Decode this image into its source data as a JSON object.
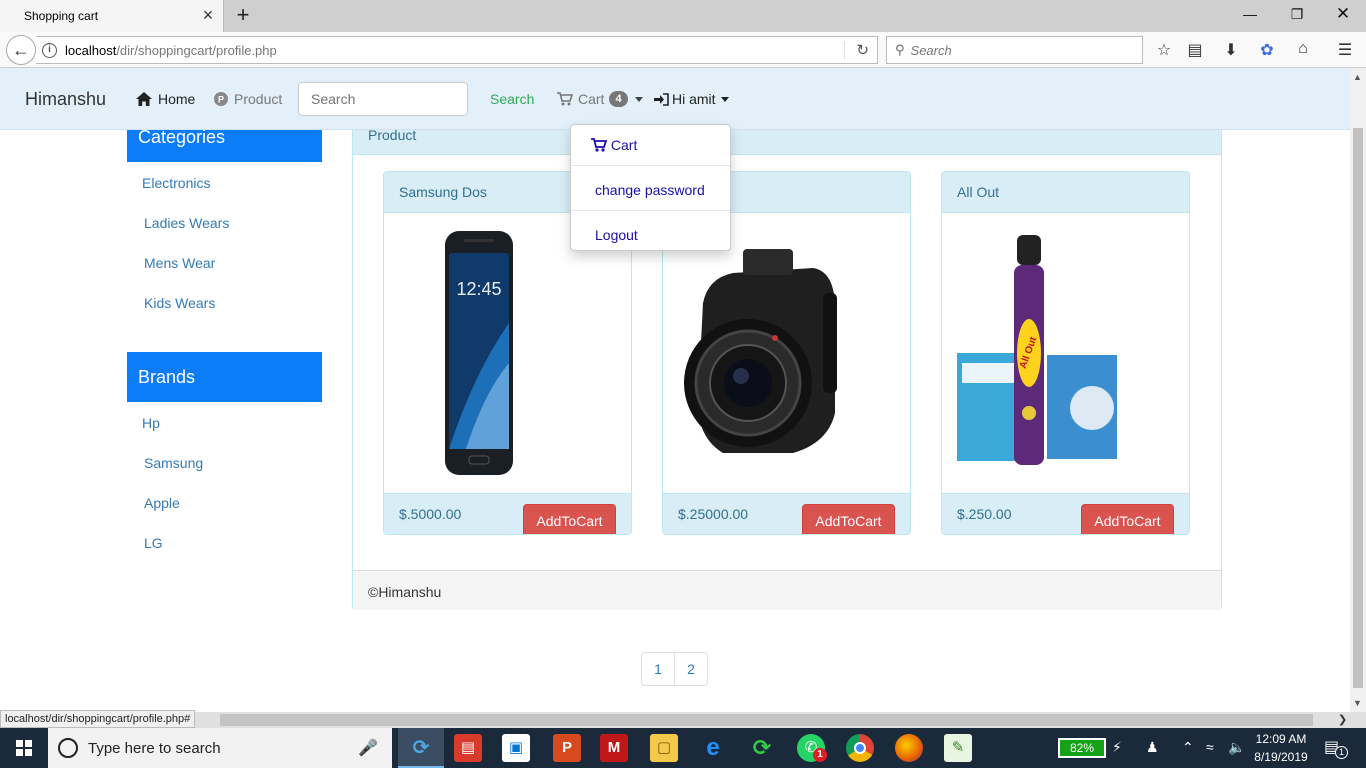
{
  "browser": {
    "tab_title": "Shopping cart",
    "new_tab_symbol": "+",
    "url_host": "localhost",
    "url_path": "/dir/shoppingcart/profile.php",
    "search_placeholder": "Search",
    "status_url": "localhost/dir/shoppingcart/profile.php#"
  },
  "site_nav": {
    "brand": "Himanshu",
    "home_label": "Home",
    "product_label": "Product",
    "search_placeholder": "Search",
    "search_button": "Search",
    "cart_label": "Cart",
    "cart_count": "4",
    "user_label": "Hi amit"
  },
  "user_menu": {
    "items": [
      "Cart",
      "change password",
      "Logout"
    ]
  },
  "sidebar": {
    "categories_title": "Categories",
    "categories": [
      "Electronics",
      "Ladies Wears",
      "Mens Wear",
      "Kids Wears"
    ],
    "brands_title": "Brands",
    "brands": [
      "Hp",
      "Samsung",
      "Apple",
      "LG"
    ]
  },
  "products_panel": {
    "title": "Product",
    "footer": "©Himanshu",
    "products": [
      {
        "name": "Samsung Dos",
        "price": "$.5000.00",
        "button": "AddToCart",
        "image_text": "12:45"
      },
      {
        "name": "",
        "price": "$.25000.00",
        "button": "AddToCart"
      },
      {
        "name": "All Out",
        "price": "$.250.00",
        "button": "AddToCart",
        "image_text": "All Out"
      }
    ]
  },
  "pagination": [
    "1",
    "2"
  ],
  "taskbar": {
    "search_placeholder": "Type here to search",
    "battery": "82%",
    "time": "12:09 AM",
    "date": "8/19/2019",
    "whatsapp_badge": "1",
    "notification_count": "1"
  },
  "colors": {
    "nav_bg": "#e3f0fa",
    "sidebar_header": "#0d7cf9",
    "panel_info": "#d9edf7",
    "danger_button": "#d9534f",
    "link": "#337ab7"
  }
}
